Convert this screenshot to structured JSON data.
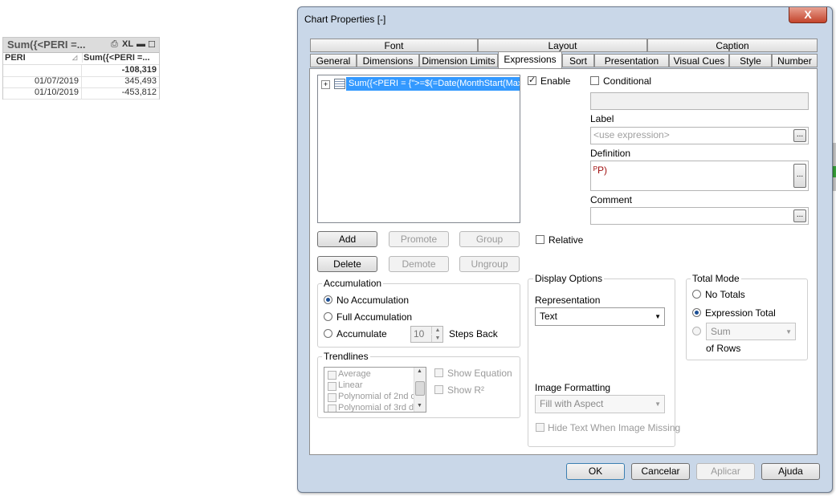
{
  "sheet": {
    "caption": "Sum({<PERI =...",
    "caption_icons": [
      "print-icon",
      "excel-icon",
      "minimize-icon",
      "maximize-icon"
    ],
    "xl_label": "XL",
    "headers": [
      "PERI",
      "Sum({<PERI =..."
    ],
    "total": "-108,319",
    "rows": [
      {
        "peri": "01/07/2019",
        "value": "345,493"
      },
      {
        "peri": "01/10/2019",
        "value": "-453,812"
      }
    ]
  },
  "dialog": {
    "title": "Chart Properties [-]",
    "close_label": "X",
    "tabs_top": [
      "Font",
      "Layout",
      "Caption"
    ],
    "tabs_bottom": [
      "General",
      "Dimensions",
      "Dimension Limits",
      "Expressions",
      "Sort",
      "Presentation",
      "Visual Cues",
      "Style",
      "Number"
    ],
    "active_tab": "Expressions",
    "expression_item": "Sum({<PERI = {\">=$(=Date(MonthStart(Max(",
    "buttons": {
      "add": "Add",
      "promote": "Promote",
      "group": "Group",
      "delete": "Delete",
      "demote": "Demote",
      "ungroup": "Ungroup"
    },
    "enable_label": "Enable",
    "conditional_label": "Conditional",
    "label_title": "Label",
    "label_placeholder": "<use expression>",
    "definition_title": "Definition",
    "definition_value": "ᴾP)",
    "comment_title": "Comment",
    "ellipsis": "...",
    "relative_label": "Relative",
    "accumulation": {
      "title": "Accumulation",
      "no": "No Accumulation",
      "full": "Full Accumulation",
      "acc": "Accumulate",
      "steps_value": "10",
      "steps_label": "Steps Back"
    },
    "trendlines": {
      "title": "Trendlines",
      "items": [
        "Average",
        "Linear",
        "Polynomial of 2nd d",
        "Polynomial of 3rd de"
      ],
      "show_equation": "Show Equation",
      "show_r2": "Show R²"
    },
    "display": {
      "title": "Display Options",
      "representation_label": "Representation",
      "representation_value": "Text",
      "image_formatting_label": "Image Formatting",
      "image_formatting_value": "Fill with Aspect",
      "hide_text_label": "Hide Text When Image Missing"
    },
    "total_mode": {
      "title": "Total Mode",
      "no_totals": "No Totals",
      "expression_total": "Expression Total",
      "sum_value": "Sum",
      "of_rows": "of Rows"
    },
    "footer": {
      "ok": "OK",
      "cancel": "Cancelar",
      "apply": "Aplicar",
      "help": "Ajuda"
    }
  }
}
